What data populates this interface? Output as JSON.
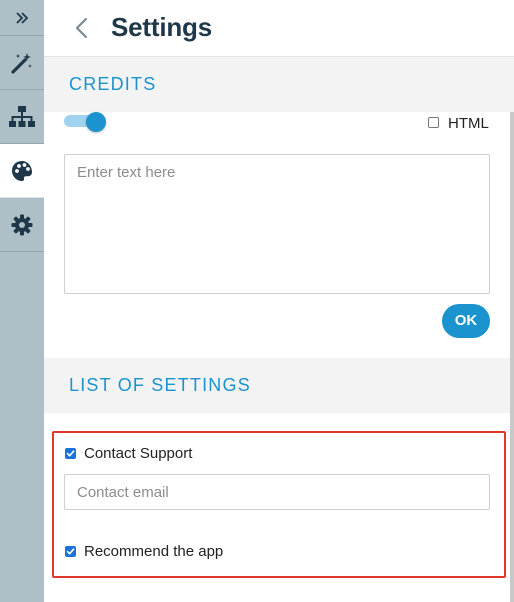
{
  "header": {
    "title": "Settings"
  },
  "rail": {
    "items": [
      {
        "icon": "double-chevron-right-icon"
      },
      {
        "icon": "magic-wand-icon"
      },
      {
        "icon": "sitemap-icon"
      },
      {
        "icon": "palette-icon",
        "active": true
      },
      {
        "icon": "gear-icon"
      }
    ]
  },
  "credits": {
    "heading": "CREDITS",
    "toggle_on": true,
    "html_label": "HTML",
    "html_checked": false,
    "text_placeholder": "Enter text here",
    "text_value": "",
    "ok_label": "OK"
  },
  "list_of_settings": {
    "heading": "LIST OF SETTINGS",
    "contact_support": {
      "label": "Contact Support",
      "checked": true
    },
    "contact_email": {
      "placeholder": "Contact email",
      "value": ""
    },
    "recommend_app": {
      "label": "Recommend the app",
      "checked": true
    }
  },
  "colors": {
    "accent": "#1a93cf",
    "title": "#1e3849",
    "rail": "#aebfc8",
    "highlight": "#e0392b",
    "checkbox": "#1a73d8"
  }
}
